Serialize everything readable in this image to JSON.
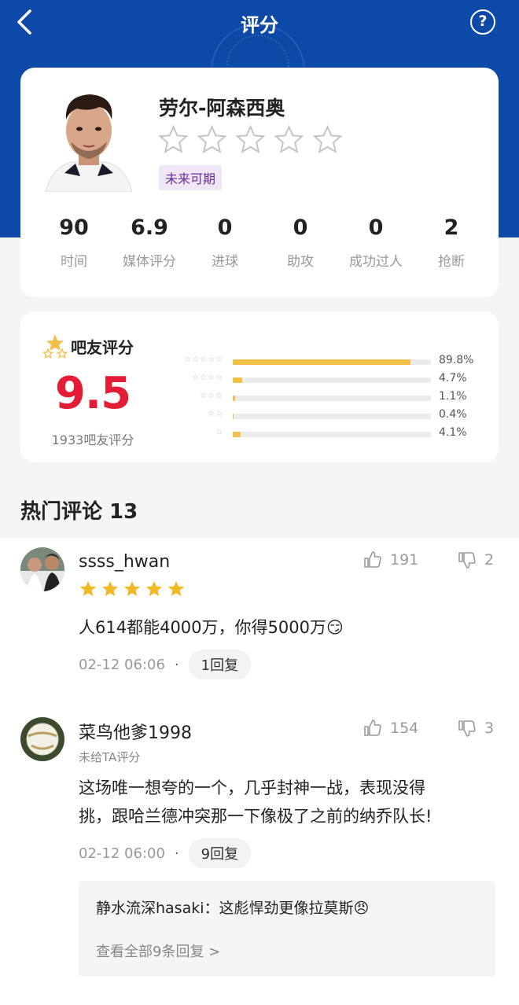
{
  "topbar": {
    "title": "评分",
    "help_label": "?"
  },
  "player": {
    "name": "劳尔-阿森西奥",
    "star_rating": 0,
    "star_max": 5,
    "tag": "未来可期",
    "stats": [
      {
        "value": "90",
        "label": "时间"
      },
      {
        "value": "6.9",
        "label": "媒体评分"
      },
      {
        "value": "0",
        "label": "进球"
      },
      {
        "value": "0",
        "label": "助攻"
      },
      {
        "value": "0",
        "label": "成功过人"
      },
      {
        "value": "2",
        "label": "抢断"
      }
    ]
  },
  "fan_rating": {
    "title": "吧友评分",
    "score": "9.5",
    "count": "1933吧友评分",
    "distribution": [
      {
        "stars": "☆☆☆☆☆",
        "fraction": 0.898,
        "pct": "89.8%"
      },
      {
        "stars": "☆☆☆☆",
        "fraction": 0.047,
        "pct": "4.7%"
      },
      {
        "stars": "☆☆☆",
        "fraction": 0.011,
        "pct": "1.1%"
      },
      {
        "stars": "☆☆",
        "fraction": 0.004,
        "pct": "0.4%"
      },
      {
        "stars": "☆",
        "fraction": 0.041,
        "pct": "4.1%"
      }
    ],
    "colors": {
      "score": "#e21d35",
      "bar": "#f0c04a"
    }
  },
  "comments_section": {
    "title": "热门评论 13",
    "comments": [
      {
        "user": "ssss_hwan",
        "stars": 5,
        "likes": "191",
        "dislikes": "2",
        "text": "人614都能4000万，你得5000万",
        "emoji": "😏",
        "time": "02-12 06:06",
        "dot": "·",
        "replies": "1回复"
      },
      {
        "user": "菜鸟他爹1998",
        "subnote": "未给TA评分",
        "likes": "154",
        "dislikes": "3",
        "text_line1": "这场唯一想夸的一个，几乎封神一战，表现没得",
        "text_line2": "挑，跟哈兰德冲突那一下像极了之前的纳乔队长!",
        "time": "02-12 06:00",
        "dot": "·",
        "replies": "9回复",
        "reply_preview": "静水流深hasaki：这彪悍劲更像拉莫斯",
        "reply_emoji": "😠",
        "reply_more": "查看全部9条回复 >"
      }
    ]
  },
  "colors": {
    "header": "#0d4aa8",
    "tag_bg": "#efe6f6",
    "tag_text": "#6a2f9a"
  }
}
